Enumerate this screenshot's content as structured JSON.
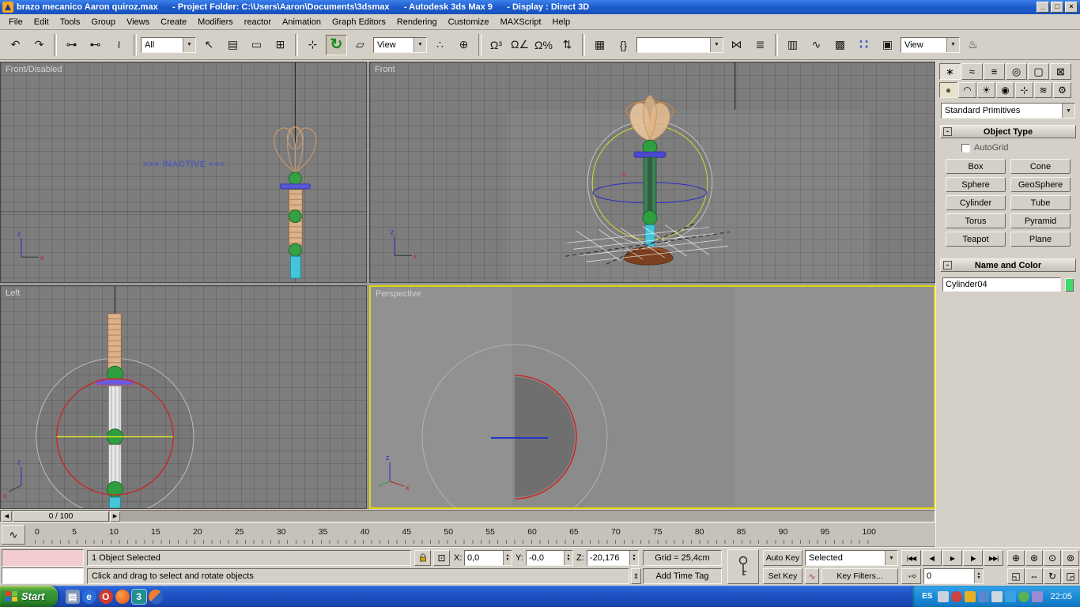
{
  "titlebar": {
    "title": "brazo mecanico Aaron quiroz.max      - Project Folder: C:\\Users\\Aaron\\Documents\\3dsmax      - Autodesk 3ds Max 9      - Display : Direct 3D",
    "minimize": "_",
    "maximize": "□",
    "close": "×"
  },
  "menubar": {
    "items": [
      "File",
      "Edit",
      "Tools",
      "Group",
      "Views",
      "Create",
      "Modifiers",
      "reactor",
      "Animation",
      "Graph Editors",
      "Rendering",
      "Customize",
      "MAXScript",
      "Help"
    ]
  },
  "ui": {
    "dropdown_arrow": "▼",
    "spinner_up": "▲",
    "spinner_down": "▼",
    "collapse_glyph": "-",
    "prompt_toggle_glyph": "⇕"
  },
  "toolbar": {
    "group1": [
      {
        "name": "undo-icon",
        "glyph": "↶",
        "interactable": true
      },
      {
        "name": "redo-icon",
        "glyph": "↷",
        "interactable": true
      },
      {
        "name": "toolbar-separator",
        "cls": "sep",
        "glyph": "",
        "interactable": false
      },
      {
        "name": "select-and-link-icon",
        "glyph": "⊶",
        "interactable": true
      },
      {
        "name": "unlink-selection-icon",
        "glyph": "⊷",
        "interactable": true
      },
      {
        "name": "bind-to-space-warp-icon",
        "glyph": "≀",
        "interactable": true
      },
      {
        "name": "toolbar-separator",
        "cls": "sep",
        "glyph": "",
        "interactable": false
      }
    ],
    "selection_filter_value": "All",
    "group2": [
      {
        "name": "select-object-icon",
        "glyph": "↖",
        "interactable": true
      },
      {
        "name": "select-by-name-icon",
        "glyph": "▤",
        "interactable": true
      },
      {
        "name": "rectangular-selection-region-icon",
        "glyph": "▭",
        "interactable": true
      },
      {
        "name": "window-crossing-icon",
        "glyph": "⊞",
        "interactable": true
      },
      {
        "name": "toolbar-separator",
        "cls": "sep",
        "glyph": "",
        "interactable": false
      },
      {
        "name": "select-and-move-icon",
        "glyph": "⊹",
        "interactable": true
      },
      {
        "name": "select-and-rotate-icon",
        "glyph": "↻",
        "cls": "active rotate",
        "interactable": true
      },
      {
        "name": "select-and-scale-icon",
        "glyph": "▱",
        "interactable": true
      }
    ],
    "reference_coordsys_value": "View",
    "group3": [
      {
        "name": "use-pivot-point-center-icon",
        "glyph": "∴",
        "interactable": true
      },
      {
        "name": "select-and-manipulate-icon",
        "glyph": "⊕",
        "interactable": true
      },
      {
        "name": "toolbar-separator",
        "cls": "sep",
        "glyph": "",
        "interactable": false
      },
      {
        "name": "snap-toggle-3d-icon",
        "glyph": "Ω³",
        "interactable": true
      },
      {
        "name": "angle-snap-icon",
        "glyph": "Ω∠",
        "interactable": true
      },
      {
        "name": "percent-snap-icon",
        "glyph": "Ω%",
        "interactable": true
      },
      {
        "name": "spinner-snap-icon",
        "glyph": "⇅",
        "interactable": true
      },
      {
        "name": "toolbar-separator",
        "cls": "sep",
        "glyph": "",
        "interactable": false
      },
      {
        "name": "keyboard-shortcut-override-icon",
        "glyph": "▦",
        "interactable": true
      },
      {
        "name": "named-selection-sets-icon",
        "glyph": "{}",
        "interactable": true
      }
    ],
    "named_selection_value": "",
    "group4": [
      {
        "name": "mirror-icon",
        "glyph": "⋈",
        "interactable": true
      },
      {
        "name": "align-icon",
        "glyph": "≣",
        "interactable": true
      },
      {
        "name": "toolbar-separator",
        "cls": "sep",
        "glyph": "",
        "interactable": false
      },
      {
        "name": "layer-manager-icon",
        "glyph": "▥",
        "interactable": true
      },
      {
        "name": "curve-editor-icon",
        "glyph": "∿",
        "interactable": true
      },
      {
        "name": "schematic-view-icon",
        "glyph": "▩",
        "interactable": true
      },
      {
        "name": "material-editor-icon",
        "glyph": "∷",
        "cls": "mat",
        "interactable": true
      },
      {
        "name": "render-scene-icon",
        "glyph": "▣",
        "interactable": true
      }
    ],
    "render_type_value": "View",
    "group5": [
      {
        "name": "quick-render-icon",
        "glyph": "♨",
        "interactable": true
      }
    ]
  },
  "viewports": {
    "front_disabled_label": "Front/Disabled",
    "inactive_text": ">>> INACTIVE <<<",
    "front_label": "Front",
    "left_label": "Left",
    "perspective_label": "Perspective",
    "active_border_color": "#e3d600"
  },
  "command_panel": {
    "tabs": [
      {
        "name": "tab-create-icon",
        "glyph": "∗",
        "cls": "active",
        "interactable": true
      },
      {
        "name": "tab-modify-icon",
        "glyph": "≈",
        "interactable": true
      },
      {
        "name": "tab-hierarchy-icon",
        "glyph": "≡",
        "interactable": true
      },
      {
        "name": "tab-motion-icon",
        "glyph": "◎",
        "interactable": true
      },
      {
        "name": "tab-display-icon",
        "glyph": "▢",
        "interactable": true
      },
      {
        "name": "tab-utilities-icon",
        "glyph": "⊠",
        "interactable": true
      }
    ],
    "categories": [
      {
        "name": "category-geometry-icon",
        "glyph": "●",
        "cls": "active",
        "interactable": true
      },
      {
        "name": "category-shapes-icon",
        "glyph": "◠",
        "interactable": true
      },
      {
        "name": "category-lights-icon",
        "glyph": "☀",
        "interactable": true
      },
      {
        "name": "category-cameras-icon",
        "glyph": "◉",
        "interactable": true
      },
      {
        "name": "category-helpers-icon",
        "glyph": "⊹",
        "interactable": true
      },
      {
        "name": "category-spacewarps-icon",
        "glyph": "≋",
        "interactable": true
      },
      {
        "name": "category-systems-icon",
        "glyph": "⚙",
        "interactable": true
      }
    ],
    "category_dropdown_value": "Standard Primitives",
    "rollout_object_type_title": "Object Type",
    "autogrid_label": "AutoGrid",
    "object_buttons": [
      "Box",
      "Cone",
      "Sphere",
      "GeoSphere",
      "Cylinder",
      "Tube",
      "Torus",
      "Pyramid",
      "Teapot",
      "Plane"
    ],
    "rollout_name_color_title": "Name and Color",
    "object_name": "Cylinder04",
    "object_color": "#3fd96a",
    "object_color_style": "background-color:#3fd96a"
  },
  "timeline": {
    "slider_label": "0 / 100",
    "prev_arrow": "◀",
    "next_arrow": "▶",
    "curve_editor_glyph": "∿",
    "ruler_labels": [
      "0",
      "5",
      "10",
      "15",
      "20",
      "25",
      "30",
      "35",
      "40",
      "45",
      "50",
      "55",
      "60",
      "65",
      "70",
      "75",
      "80",
      "85",
      "90",
      "95",
      "100"
    ]
  },
  "statusbar": {
    "selection_status": "1 Object Selected",
    "prompt": "Click and drag to select and rotate objects",
    "coord_x_label": "X:",
    "coord_x_value": "0,0",
    "coord_y_label": "Y:",
    "coord_y_value": "-0,0",
    "coord_z_label": "Z:",
    "coord_z_value": "-20,176",
    "grid_size": "Grid = 25,4cm",
    "add_time_tag": "Add Time Tag",
    "auto_key_label": "Auto Key",
    "set_key_label": "Set Key",
    "key_mode_value": "Selected",
    "key_filters_label": "Key Filters...",
    "current_frame_value": "0",
    "playback": [
      {
        "name": "go-to-start-button",
        "glyph": "|◀◀",
        "interactable": true
      },
      {
        "name": "previous-frame-button",
        "glyph": "◀|",
        "interactable": true
      },
      {
        "name": "play-button",
        "glyph": "▶",
        "interactable": true
      },
      {
        "name": "next-frame-button",
        "glyph": "|▶",
        "interactable": true
      },
      {
        "name": "go-to-end-button",
        "glyph": "▶▶|",
        "interactable": true
      }
    ],
    "nav_row1": [
      {
        "name": "zoom-icon",
        "glyph": "⊕",
        "interactable": true
      },
      {
        "name": "zoom-all-icon",
        "glyph": "⊛",
        "interactable": true
      },
      {
        "name": "zoom-extents-icon",
        "glyph": "⊙",
        "interactable": true
      },
      {
        "name": "zoom-extents-all-icon",
        "glyph": "⊚",
        "interactable": true
      }
    ],
    "nav_row2": [
      {
        "name": "zoom-region-icon",
        "glyph": "◱",
        "interactable": true
      },
      {
        "name": "pan-icon",
        "glyph": "⇔",
        "interactable": true
      },
      {
        "name": "arc-rotate-icon",
        "glyph": "↻",
        "interactable": true
      },
      {
        "name": "min-max-toggle-icon",
        "glyph": "◲",
        "interactable": true
      }
    ]
  },
  "taskbar": {
    "start_label": "Start",
    "quicklaunch": [
      {
        "name": "show-desktop-icon",
        "glyph": "▤",
        "style": "background:#7f96b6",
        "interactable": true
      },
      {
        "name": "internet-explorer-icon",
        "glyph": "e",
        "style": "background:#2a6fd6;border-radius:50%",
        "interactable": true
      },
      {
        "name": "opera-icon",
        "glyph": "O",
        "style": "background:#d03a2a;border-radius:50%",
        "interactable": true
      },
      {
        "name": "firefox-icon",
        "glyph": "",
        "style": "background:radial-gradient(circle at 35% 35%,#ffa04c,#d94f10);border-radius:50%",
        "interactable": true
      },
      {
        "name": "3dsmax-quicklaunch-icon",
        "glyph": "3",
        "style": "background:#1f8f8f;box-shadow:0 0 0 1px #9cc4ee",
        "interactable": true
      },
      {
        "name": "media-player-icon",
        "glyph": "",
        "style": "background:linear-gradient(135deg,#f08030 50%,#3060c0 50%);border-radius:50%",
        "interactable": true
      }
    ],
    "language": "ES",
    "tray": [
      {
        "name": "tray-tablet-icon",
        "style": "background:#c8d2e0",
        "interactable": true
      },
      {
        "name": "tray-antivirus-icon",
        "style": "background:#d04040;border-radius:50%",
        "interactable": true
      },
      {
        "name": "tray-update-icon",
        "style": "background:#e8b020",
        "interactable": true
      },
      {
        "name": "tray-network-icon",
        "style": "background:#5588cc",
        "interactable": true
      },
      {
        "name": "tray-volume-icon",
        "style": "background:#cfd6de",
        "interactable": true
      },
      {
        "name": "tray-display-icon",
        "style": "background:#3aa0e0",
        "interactable": true
      },
      {
        "name": "tray-messenger-icon",
        "style": "background:#58b058;border-radius:50%",
        "interactable": true
      },
      {
        "name": "tray-sync-icon",
        "style": "background:#9a8ad0",
        "interactable": true
      }
    ],
    "clock": "22:05"
  }
}
